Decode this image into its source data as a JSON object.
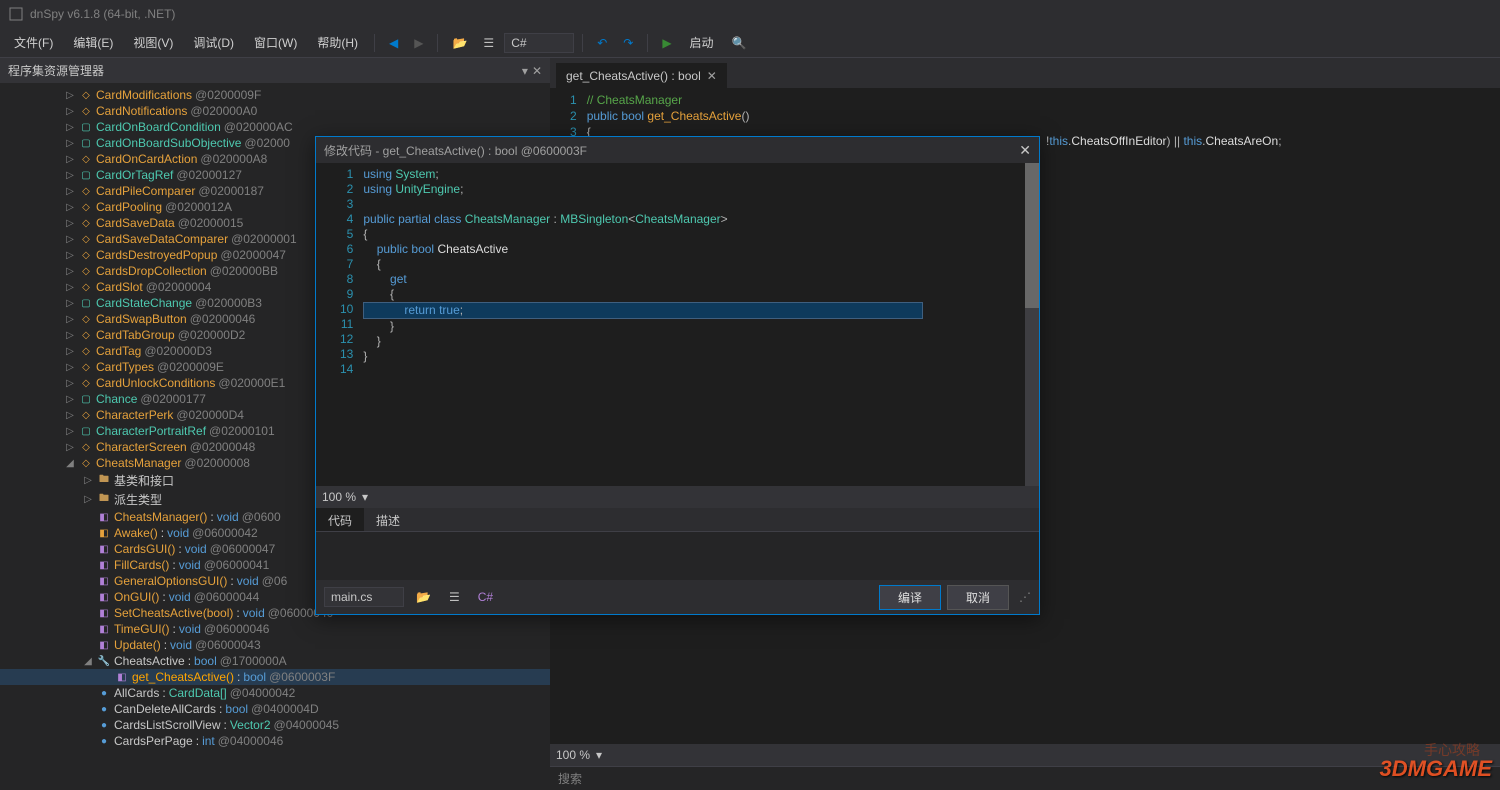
{
  "title": "dnSpy v6.1.8 (64-bit, .NET)",
  "menu": {
    "file": "文件(F)",
    "edit": "编辑(E)",
    "view": "视图(V)",
    "debug": "调试(D)",
    "window": "窗口(W)",
    "help": "帮助(H)"
  },
  "toolbar": {
    "lang": "C#",
    "start": "启动"
  },
  "panel": {
    "title": "程序集资源管理器"
  },
  "tree": [
    {
      "i": 0,
      "exp": "▷",
      "ic": "class",
      "kind": "type-o",
      "name": "CardModifications",
      "tok": "@0200009F"
    },
    {
      "i": 0,
      "exp": "▷",
      "ic": "class",
      "kind": "type-o",
      "name": "CardNotifications",
      "tok": "@020000A0"
    },
    {
      "i": 0,
      "exp": "▷",
      "ic": "struct",
      "kind": "type",
      "name": "CardOnBoardCondition",
      "tok": "@020000AC"
    },
    {
      "i": 0,
      "exp": "▷",
      "ic": "struct",
      "kind": "type",
      "name": "CardOnBoardSubObjective",
      "tok": "@02000"
    },
    {
      "i": 0,
      "exp": "▷",
      "ic": "class",
      "kind": "type-o",
      "name": "CardOnCardAction",
      "tok": "@020000A8"
    },
    {
      "i": 0,
      "exp": "▷",
      "ic": "struct",
      "kind": "type",
      "name": "CardOrTagRef",
      "tok": "@02000127"
    },
    {
      "i": 0,
      "exp": "▷",
      "ic": "class",
      "kind": "type-o",
      "name": "CardPileComparer",
      "tok": "@02000187"
    },
    {
      "i": 0,
      "exp": "▷",
      "ic": "class",
      "kind": "type-o",
      "name": "CardPooling",
      "tok": "@0200012A"
    },
    {
      "i": 0,
      "exp": "▷",
      "ic": "class",
      "kind": "type-o",
      "name": "CardSaveData",
      "tok": "@02000015"
    },
    {
      "i": 0,
      "exp": "▷",
      "ic": "class",
      "kind": "type-o",
      "name": "CardSaveDataComparer",
      "tok": "@02000001"
    },
    {
      "i": 0,
      "exp": "▷",
      "ic": "class",
      "kind": "type-o",
      "name": "CardsDestroyedPopup",
      "tok": "@02000047"
    },
    {
      "i": 0,
      "exp": "▷",
      "ic": "class",
      "kind": "type-o",
      "name": "CardsDropCollection",
      "tok": "@020000BB"
    },
    {
      "i": 0,
      "exp": "▷",
      "ic": "class",
      "kind": "type-o",
      "name": "CardSlot",
      "tok": "@02000004"
    },
    {
      "i": 0,
      "exp": "▷",
      "ic": "struct",
      "kind": "type",
      "name": "CardStateChange",
      "tok": "@020000B3"
    },
    {
      "i": 0,
      "exp": "▷",
      "ic": "class",
      "kind": "type-o",
      "name": "CardSwapButton",
      "tok": "@02000046"
    },
    {
      "i": 0,
      "exp": "▷",
      "ic": "class",
      "kind": "type-o",
      "name": "CardTabGroup",
      "tok": "@020000D2"
    },
    {
      "i": 0,
      "exp": "▷",
      "ic": "class",
      "kind": "type-o",
      "name": "CardTag",
      "tok": "@020000D3"
    },
    {
      "i": 0,
      "exp": "▷",
      "ic": "class",
      "kind": "type-o",
      "name": "CardTypes",
      "tok": "@0200009E"
    },
    {
      "i": 0,
      "exp": "▷",
      "ic": "class",
      "kind": "type-o",
      "name": "CardUnlockConditions",
      "tok": "@020000E1"
    },
    {
      "i": 0,
      "exp": "▷",
      "ic": "struct",
      "kind": "type",
      "name": "Chance",
      "tok": "@02000177"
    },
    {
      "i": 0,
      "exp": "▷",
      "ic": "class",
      "kind": "type-o",
      "name": "CharacterPerk",
      "tok": "@020000D4"
    },
    {
      "i": 0,
      "exp": "▷",
      "ic": "struct",
      "kind": "type",
      "name": "CharacterPortraitRef",
      "tok": "@02000101"
    },
    {
      "i": 0,
      "exp": "▷",
      "ic": "class",
      "kind": "type-o",
      "name": "CharacterScreen",
      "tok": "@02000048"
    },
    {
      "i": 0,
      "exp": "◢",
      "ic": "class",
      "kind": "type-o",
      "name": "CheatsManager",
      "tok": "@02000008"
    },
    {
      "i": 1,
      "exp": "▷",
      "ic": "folder",
      "kind": "plain",
      "name": "基类和接口",
      "tok": ""
    },
    {
      "i": 1,
      "exp": "▷",
      "ic": "folder",
      "kind": "plain",
      "name": "派生类型",
      "tok": ""
    },
    {
      "i": 1,
      "exp": "",
      "ic": "method",
      "kind": "method",
      "name": "CheatsManager()",
      "ret": "void",
      "tok": "@0600"
    },
    {
      "i": 1,
      "exp": "",
      "ic": "method-o",
      "kind": "method",
      "name": "Awake()",
      "ret": "void",
      "tok": "@06000042"
    },
    {
      "i": 1,
      "exp": "",
      "ic": "method",
      "kind": "method",
      "name": "CardsGUI()",
      "ret": "void",
      "tok": "@06000047"
    },
    {
      "i": 1,
      "exp": "",
      "ic": "method",
      "kind": "method",
      "name": "FillCards()",
      "ret": "void",
      "tok": "@06000041"
    },
    {
      "i": 1,
      "exp": "",
      "ic": "method",
      "kind": "method",
      "name": "GeneralOptionsGUI()",
      "ret": "void",
      "tok": "@06"
    },
    {
      "i": 1,
      "exp": "",
      "ic": "method",
      "kind": "method",
      "name": "OnGUI()",
      "ret": "void",
      "tok": "@06000044"
    },
    {
      "i": 1,
      "exp": "",
      "ic": "method",
      "kind": "method",
      "name": "SetCheatsActive(bool)",
      "ret": "void",
      "tok": "@06000040"
    },
    {
      "i": 1,
      "exp": "",
      "ic": "method",
      "kind": "method",
      "name": "TimeGUI()",
      "ret": "void",
      "tok": "@06000046"
    },
    {
      "i": 1,
      "exp": "",
      "ic": "method",
      "kind": "method",
      "name": "Update()",
      "ret": "void",
      "tok": "@06000043"
    },
    {
      "i": 1,
      "exp": "◢",
      "ic": "prop",
      "kind": "plain",
      "name": "CheatsActive",
      "ret": "bool",
      "tok": "@1700000A"
    },
    {
      "i": 2,
      "exp": "",
      "ic": "method",
      "kind": "method-sel",
      "name": "get_CheatsActive()",
      "ret": "bool",
      "tok": "@0600003F",
      "sel": true
    },
    {
      "i": 1,
      "exp": "",
      "ic": "field",
      "kind": "plain",
      "name": "AllCards",
      "ret": "CardData[]",
      "tok": "@04000042"
    },
    {
      "i": 1,
      "exp": "",
      "ic": "field",
      "kind": "plain",
      "name": "CanDeleteAllCards",
      "ret": "bool",
      "tok": "@0400004D"
    },
    {
      "i": 1,
      "exp": "",
      "ic": "field",
      "kind": "plain",
      "name": "CardsListScrollView",
      "ret": "Vector2",
      "tok": "@04000045"
    },
    {
      "i": 1,
      "exp": "",
      "ic": "field",
      "kind": "plain",
      "name": "CardsPerPage",
      "ret": "int",
      "tok": "@04000046"
    }
  ],
  "tab": {
    "label": "get_CheatsActive() : bool"
  },
  "mainCode": {
    "lines": [
      {
        "n": 1,
        "html": "<span class='tok-comment'>// CheatsManager</span>"
      },
      {
        "n": 2,
        "html": "<span class='tok-kw'>public</span> <span class='tok-kw'>bool</span> <span class='tok-method'>get_CheatsActive</span><span class='tok-op'>()</span>"
      },
      {
        "n": 3,
        "html": "<span class='tok-op'>{</span>"
      }
    ],
    "overflow": "<span class='tok-op'>!</span><span class='tok-kw'>this</span><span class='tok-op'>.</span><span class='tok-plain'>CheatsOffInEditor</span><span class='tok-op'>)  ||  </span><span class='tok-kw'>this</span><span class='tok-op'>.</span><span class='tok-plain'>CheatsAreOn</span><span class='tok-op'>;</span>"
  },
  "zoom": "100 %",
  "search": "搜索",
  "dialog": {
    "title": "修改代码 - get_CheatsActive() : bool @0600003F",
    "lines": [
      {
        "n": 1,
        "html": "<span class='tok-kw'>using</span> <span class='tok-type'>System</span><span class='tok-op'>;</span>"
      },
      {
        "n": 2,
        "html": "<span class='tok-kw'>using</span> <span class='tok-type'>UnityEngine</span><span class='tok-op'>;</span>"
      },
      {
        "n": 3,
        "html": ""
      },
      {
        "n": 4,
        "html": "<span class='tok-kw'>public</span> <span class='tok-kw'>partial</span> <span class='tok-kw'>class</span> <span class='tok-type'>CheatsManager</span> <span class='tok-op'>:</span> <span class='tok-type'>MBSingleton</span><span class='tok-op'>&lt;</span><span class='tok-type'>CheatsManager</span><span class='tok-op'>&gt;</span>"
      },
      {
        "n": 5,
        "html": "<span class='tok-op'>{</span>"
      },
      {
        "n": 6,
        "html": "    <span class='tok-kw'>public</span> <span class='tok-kw'>bool</span> <span class='tok-plain'>CheatsActive</span>"
      },
      {
        "n": 7,
        "html": "    <span class='tok-op'>{</span>"
      },
      {
        "n": 8,
        "html": "        <span class='tok-kw'>get</span>"
      },
      {
        "n": 9,
        "html": "        <span class='tok-op'>{</span>"
      },
      {
        "n": 10,
        "html": "",
        "hl": "            <span class='tok-kw'>return</span> <span class='tok-kw'>true</span><span class='tok-op'>;</span>"
      },
      {
        "n": 11,
        "html": "        <span class='tok-op'>}</span>"
      },
      {
        "n": 12,
        "html": "    <span class='tok-op'>}</span>"
      },
      {
        "n": 13,
        "html": "<span class='tok-op'>}</span>"
      },
      {
        "n": 14,
        "html": ""
      }
    ],
    "tabs": {
      "code": "代码",
      "desc": "描述"
    },
    "file": "main.cs",
    "lang": "C#",
    "compile": "编译",
    "cancel": "取消"
  },
  "watermark": "3DMGAME",
  "watermark2": "手心攻略"
}
